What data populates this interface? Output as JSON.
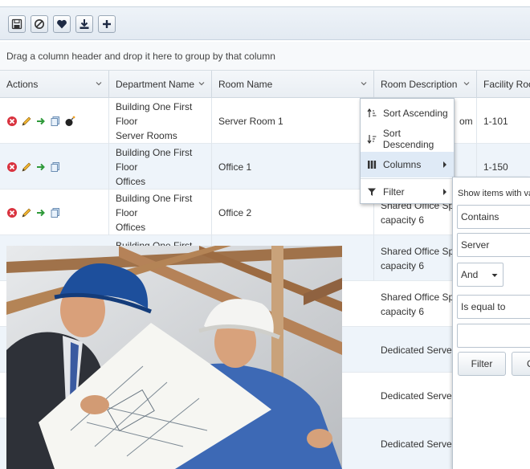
{
  "toolbar": {
    "buttons": [
      {
        "icon": "save-icon"
      },
      {
        "icon": "cancel-icon"
      },
      {
        "icon": "heart-icon"
      },
      {
        "icon": "download-icon"
      },
      {
        "icon": "add-icon"
      }
    ]
  },
  "group_bar": {
    "text": "Drag a column header and drop it here to group by that column"
  },
  "columns": [
    {
      "label": "Actions"
    },
    {
      "label": "Department Name"
    },
    {
      "label": "Room Name"
    },
    {
      "label": "Room Description"
    },
    {
      "label": "Facility Room"
    }
  ],
  "rows": [
    {
      "department": [
        "Building One First Floor",
        "Server Rooms"
      ],
      "room": "Server Room 1",
      "description": [
        "",
        "om"
      ],
      "facility": "1-101"
    },
    {
      "department": [
        "Building One First Floor",
        "Offices"
      ],
      "room": "Office 1",
      "description": [
        "",
        ""
      ],
      "facility": "1-150"
    },
    {
      "department": [
        "Building One First Floor",
        "Offices"
      ],
      "room": "Office 2",
      "description": [
        "Shared Office Space",
        "capacity 6"
      ],
      "facility": ""
    },
    {
      "department": [
        "Building One First Floor",
        ""
      ],
      "room": "",
      "description": [
        "Shared Office Space",
        "capacity 6"
      ],
      "facility": ""
    },
    {
      "department": [
        "",
        ""
      ],
      "room": "",
      "description": [
        "Shared Office Space",
        "capacity 6"
      ],
      "facility": ""
    },
    {
      "department": [
        "",
        ""
      ],
      "room": "",
      "description": [
        "Dedicated Server Ro",
        ""
      ],
      "facility": ""
    },
    {
      "department": [
        "",
        ""
      ],
      "room": "",
      "description": [
        "Dedicated Server Ro",
        ""
      ],
      "facility": ""
    },
    {
      "department": [
        "",
        ""
      ],
      "room": "",
      "description": [
        "Dedicated Server Ro",
        ""
      ],
      "facility": ""
    }
  ],
  "column_menu": {
    "sort_ascending": "Sort Ascending",
    "sort_descending": "Sort Descending",
    "columns": "Columns",
    "filter": "Filter"
  },
  "filter_panel": {
    "title": "Show items with value that:",
    "operator1": "Contains",
    "value1": "Server",
    "logic": "And",
    "operator2": "Is equal to",
    "value2": "",
    "filter_button": "Filter",
    "clear_button": "Clear"
  },
  "colors": {
    "toolbar_bg": "#e3eaf2",
    "alt_row": "#eef4fa",
    "menu_highlight": "#dfeaf6",
    "hardhat_blue": "#1d4f9c"
  }
}
